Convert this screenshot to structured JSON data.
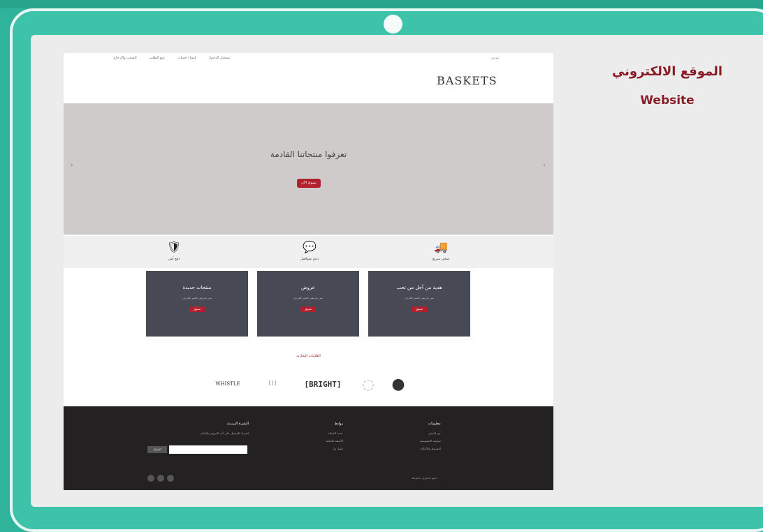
{
  "presentation": {
    "title_ar": "الموقع الالكتروني",
    "title_en": "Website"
  },
  "site": {
    "logo": "BASKETS",
    "topnav_right": "عربي",
    "topnav_left": [
      "تسجيل الدخول",
      "إنشاء حساب",
      "تتبع الطلب",
      "الشحن والإرجاع"
    ],
    "hero": {
      "title": "تعرفوا منتجاتنا القادمة",
      "button": "تسوق الآن",
      "prev": "‹",
      "next": "›"
    },
    "features": [
      {
        "icon": "truck-icon",
        "glyph": "🚚",
        "label": "شحن سريع"
      },
      {
        "icon": "chat-icon",
        "glyph": "💬",
        "label": "دعم متواصل"
      },
      {
        "icon": "shield-icon",
        "glyph": "🛡",
        "label": "دفع آمن"
      }
    ],
    "cards": [
      {
        "title": "هدية من أجل من تحب",
        "desc": "نص تعريفي قصير للعرض",
        "button": "تسوق"
      },
      {
        "title": "عروض",
        "desc": "نص تعريفي قصير للعرض",
        "button": "تسوق"
      },
      {
        "title": "منتجات جديدة",
        "desc": "نص تعريفي قصير للعرض",
        "button": "تسوق"
      }
    ],
    "brands_title": "العلامات التجارية",
    "brands": [
      "●",
      "◌",
      "[BRIGHT]",
      "⌇⌇⌇",
      "WHISTLE"
    ],
    "footer": {
      "col1": {
        "heading": "معلومات",
        "links": [
          "عن المتجر",
          "سياسة الخصوصية",
          "الشروط والأحكام"
        ]
      },
      "col2": {
        "heading": "روابط",
        "links": [
          "خدمة العملاء",
          "الأسئلة الشائعة",
          "اتصل بنا"
        ]
      },
      "col3": {
        "heading": "النشرة البريدية",
        "text": "اشترك للحصول على آخر العروض والأخبار"
      },
      "subscribe_button": "اشترك",
      "copyright": "جميع الحقوق محفوظة"
    }
  },
  "colors": {
    "frame": "#3cc3aa",
    "accent": "#b21f2d",
    "card": "#474a55",
    "footer": "#232122",
    "title": "#8a1c27"
  }
}
